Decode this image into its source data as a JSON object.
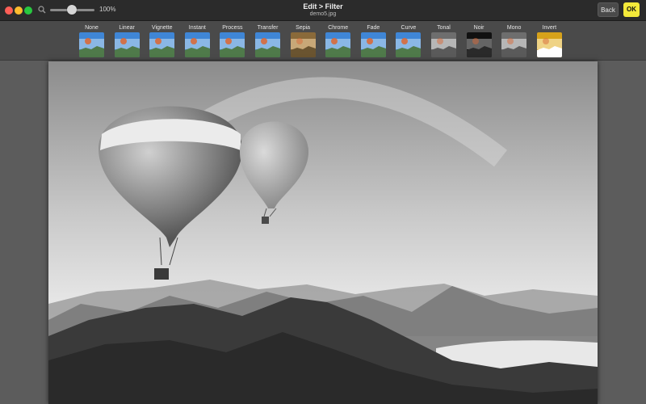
{
  "window": {
    "title": "Edit > Filter",
    "subtitle": "demo5.jpg",
    "zoom_label": "100%",
    "zoom_level": 0.5,
    "back_label": "Back",
    "ok_label": "OK",
    "accent": "#f4e93a"
  },
  "filters": [
    {
      "label": "None",
      "tone": "color",
      "selected": true
    },
    {
      "label": "Linear",
      "tone": "color"
    },
    {
      "label": "Vignette",
      "tone": "color"
    },
    {
      "label": "Instant",
      "tone": "color"
    },
    {
      "label": "Process",
      "tone": "color"
    },
    {
      "label": "Transfer",
      "tone": "color"
    },
    {
      "label": "Sepia",
      "tone": "sepia"
    },
    {
      "label": "Chrome",
      "tone": "color"
    },
    {
      "label": "Fade",
      "tone": "color"
    },
    {
      "label": "Curve",
      "tone": "color"
    },
    {
      "label": "Tonal",
      "tone": "gray"
    },
    {
      "label": "Noir",
      "tone": "noir"
    },
    {
      "label": "Mono",
      "tone": "gray"
    },
    {
      "label": "Invert",
      "tone": "invert"
    }
  ],
  "image": {
    "description_icon": "photo-balloons-mountains",
    "filter_applied": "Mono"
  }
}
